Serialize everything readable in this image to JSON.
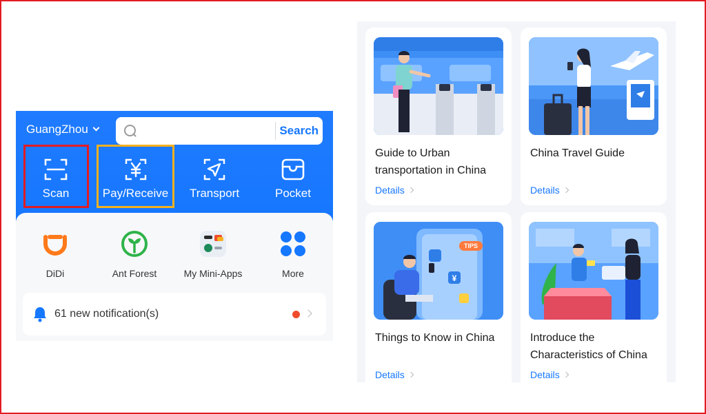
{
  "header": {
    "city": "GuangZhou",
    "search_placeholder": "",
    "search_button": "Search"
  },
  "tools": [
    {
      "label": "Scan",
      "icon": "scan-icon"
    },
    {
      "label": "Pay/Receive",
      "icon": "yuan-icon"
    },
    {
      "label": "Transport",
      "icon": "transport-icon"
    },
    {
      "label": "Pocket",
      "icon": "wallet-icon"
    }
  ],
  "apps": [
    {
      "label": "DiDi",
      "icon": "didi-icon"
    },
    {
      "label": "Ant Forest",
      "icon": "ant-forest-icon"
    },
    {
      "label": "My Mini-Apps",
      "icon": "mini-apps-icon"
    },
    {
      "label": "More",
      "icon": "more-icon"
    }
  ],
  "notification": {
    "text": "61 new notification(s)",
    "icon": "bell-icon"
  },
  "guides": [
    {
      "title": "Guide to Urban transportation in China",
      "details": "Details"
    },
    {
      "title": "China Travel Guide",
      "details": "Details"
    },
    {
      "title": "Things to Know in China",
      "details": "Details"
    },
    {
      "title": "Introduce the Characteristics of China",
      "details": "Details"
    }
  ],
  "colors": {
    "brand_blue": "#1677ff",
    "highlight_red": "#e21b22",
    "highlight_yellow": "#f5b01e",
    "notification_dot": "#f04c2b"
  }
}
